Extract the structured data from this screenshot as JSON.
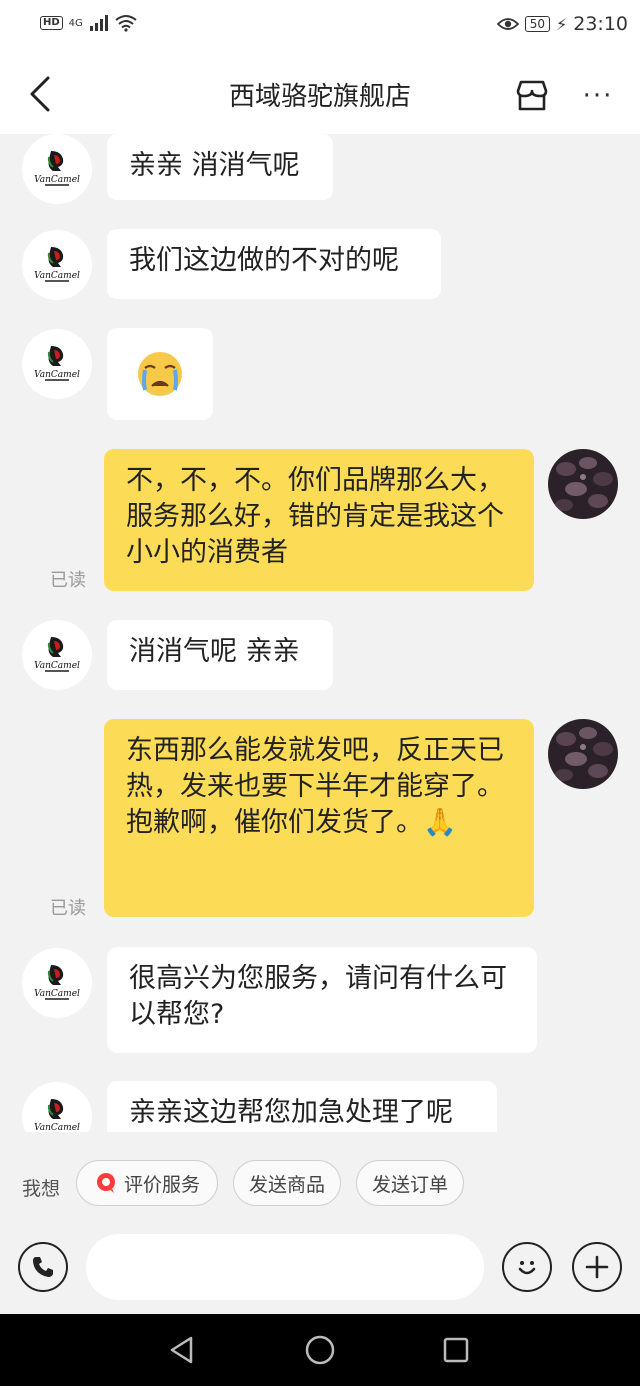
{
  "status_bar": {
    "hd": "HD",
    "network": "4G",
    "battery": "50",
    "time": "23:10"
  },
  "header": {
    "title": "西域骆驼旗舰店",
    "more": "···"
  },
  "messages": [
    {
      "side": "in",
      "text": "亲亲 消消气呢"
    },
    {
      "side": "in",
      "text": "我们这边做的不对的呢"
    },
    {
      "side": "in",
      "text": "😭"
    },
    {
      "side": "out",
      "text": "不，不，不。你们品牌那么大，服务那么好，错的肯定是我这个小小的消费者",
      "status": "已读"
    },
    {
      "side": "in",
      "text": "消消气呢 亲亲"
    },
    {
      "side": "out",
      "text": "东西那么能发就发吧，反正天已热，发来也要下半年才能穿了。抱歉啊，催你们发货了。🙏",
      "status": "已读"
    },
    {
      "side": "in",
      "text": "很高兴为您服务，请问有什么可以帮您?"
    },
    {
      "side": "in",
      "text": "亲亲这边帮您加急处理了呢"
    }
  ],
  "quick_actions": {
    "label": "我想",
    "chips": [
      "评价服务",
      "发送商品",
      "发送订单"
    ]
  },
  "input": {
    "value": "",
    "placeholder": ""
  },
  "colors": {
    "outgoing_bubble": "#fcdc57",
    "incoming_bubble": "#ffffff",
    "background": "#f2f2f2"
  }
}
